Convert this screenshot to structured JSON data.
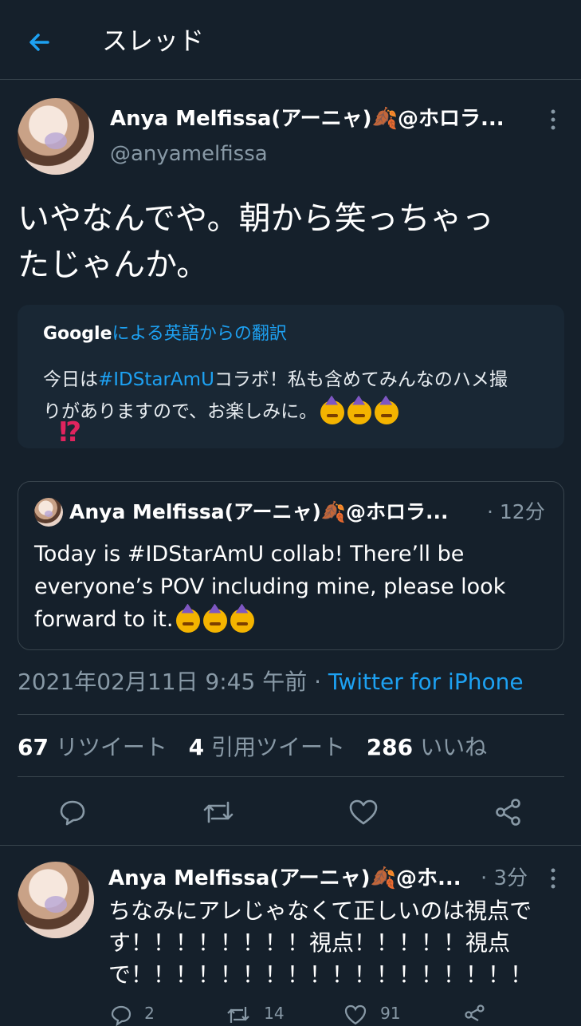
{
  "header": {
    "title": "スレッド",
    "back_icon": "arrow-left-icon"
  },
  "tweet": {
    "display_name": "Anya Melfissa(アーニャ)🍂@ホロラ...",
    "handle": "@anyamelfissa",
    "text_line1": "いやなんでや。朝から笑っちゃっ",
    "text_line2": "たじゃんか。",
    "translation": {
      "brand": "Google",
      "label": "による英語からの翻訳",
      "line1_prefix": "今日は",
      "line1_hashtag": "#IDStarAmU",
      "line1_suffix": "コラボ！私も含めてみんなのハメ撮",
      "line2": "りがありますので、お楽しみに。",
      "reaction": "⁉"
    },
    "quoted": {
      "display_name": "Anya Melfissa(アーニャ)🍂@ホロラ...",
      "time": "· 12分",
      "line1": "Today is #IDStarAmU collab! There’ll be",
      "line2": "everyone’s POV including mine, please look",
      "line3": "forward to it."
    },
    "meta": {
      "datetime": "2021年02月11日 9:45 午前 ·",
      "source": "Twitter for iPhone"
    },
    "stats": {
      "retweets_count": "67",
      "retweets_label": "リツイート",
      "quotes_count": "4",
      "quotes_label": "引用ツイート",
      "likes_count": "286",
      "likes_label": "いいね"
    }
  },
  "reply": {
    "display_name": "Anya Melfissa(アーニャ)🍂@ホ...",
    "time": "· 3分",
    "line1": "ちなみにアレじゃなくて正しいのは視点で",
    "line2": "す！！！！！！！！視点！！！！！視点",
    "line3": "で！！！！！！！！！！！！！！！！！！",
    "reply_count": "2",
    "retweet_count": "14",
    "like_count": "91"
  },
  "colors": {
    "background": "#15202b",
    "accent": "#1da1f2",
    "muted": "#8899a6",
    "divider": "#38444d"
  }
}
